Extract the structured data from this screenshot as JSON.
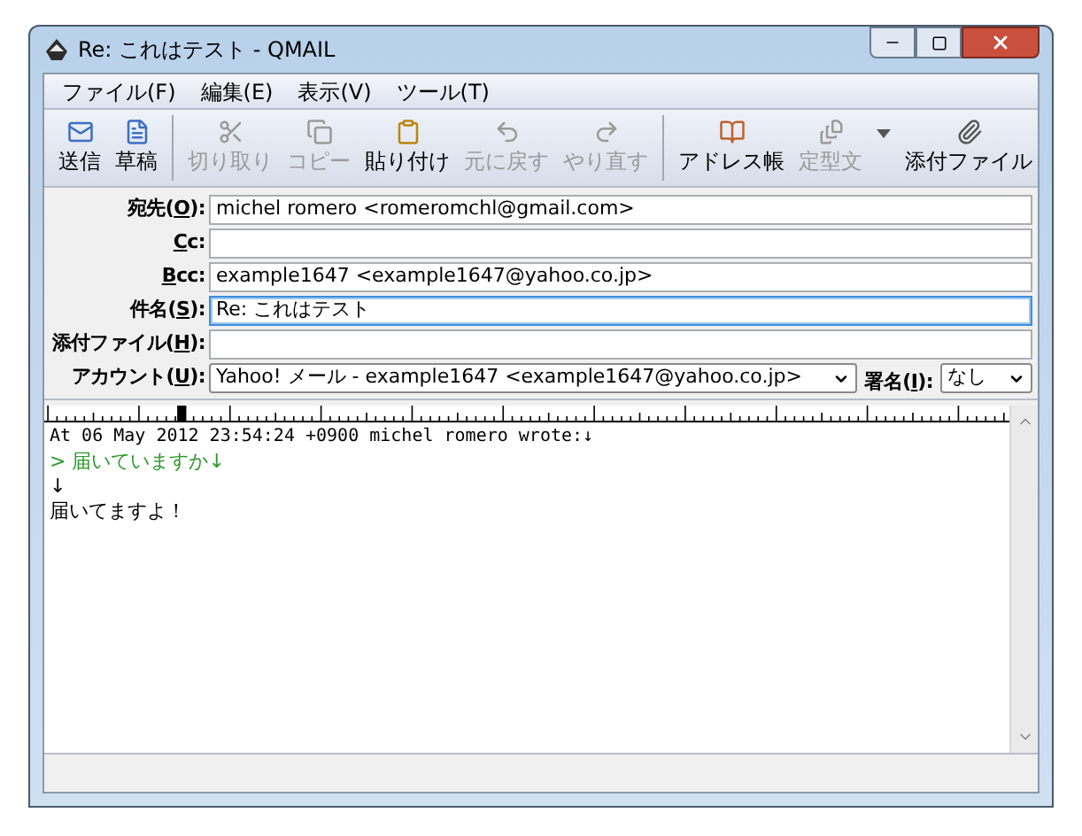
{
  "window": {
    "title": "Re: これはテスト - QMAIL"
  },
  "menu": [
    "ファイル(F)",
    "編集(E)",
    "表示(V)",
    "ツール(T)"
  ],
  "toolbar": {
    "groups": [
      [
        {
          "label": "送信",
          "disabled": false
        },
        {
          "label": "草稿",
          "disabled": false
        }
      ],
      [
        {
          "label": "切り取り",
          "disabled": true
        },
        {
          "label": "コピー",
          "disabled": true
        },
        {
          "label": "貼り付け",
          "disabled": false
        },
        {
          "label": "元に戻す",
          "disabled": true
        },
        {
          "label": "やり直す",
          "disabled": true
        }
      ],
      [
        {
          "label": "アドレス帳",
          "disabled": false
        },
        {
          "label": "定型文",
          "disabled": true,
          "dropdown": true
        },
        {
          "label": "添付ファイル",
          "disabled": false
        }
      ]
    ]
  },
  "header_fields": [
    {
      "label_before": "宛先(",
      "accel": "O",
      "label_after": "):",
      "kind": "text",
      "value": "michel romero <romeromchl@gmail.com>",
      "focused": false
    },
    {
      "accel": "C",
      "label_after": "c:",
      "kind": "text",
      "focused": false
    },
    {
      "accel": "B",
      "label_after": "cc:",
      "kind": "text",
      "value": "example1647 <example1647@yahoo.co.jp>",
      "focused": false
    },
    {
      "label_before": "件名(",
      "accel": "S",
      "label_after": "):",
      "kind": "text",
      "value": "Re: これはテスト",
      "focused": true
    },
    {
      "label_before": "添付ファイル(",
      "accel": "H",
      "label_after": "):",
      "kind": "text",
      "focused": false
    },
    {
      "label_before": "アカウント(",
      "accel": "U",
      "label_after": "):",
      "kind": "select",
      "value": "Yahoo! メール - example1647 <example1647@yahoo.co.jp>",
      "extra": {
        "label_before": "署名(",
        "accel": "I",
        "label_after": "):",
        "value": "なし"
      }
    }
  ],
  "body": [
    {
      "kind": "header",
      "text": "At 06 May 2012 23:54:24 +0900 michel romero wrote:↓"
    },
    {
      "kind": "quote",
      "text": "> 届いていますか↓"
    },
    {
      "kind": "text",
      "text": "↓"
    },
    {
      "kind": "text",
      "text": "届いてますよ！"
    }
  ]
}
